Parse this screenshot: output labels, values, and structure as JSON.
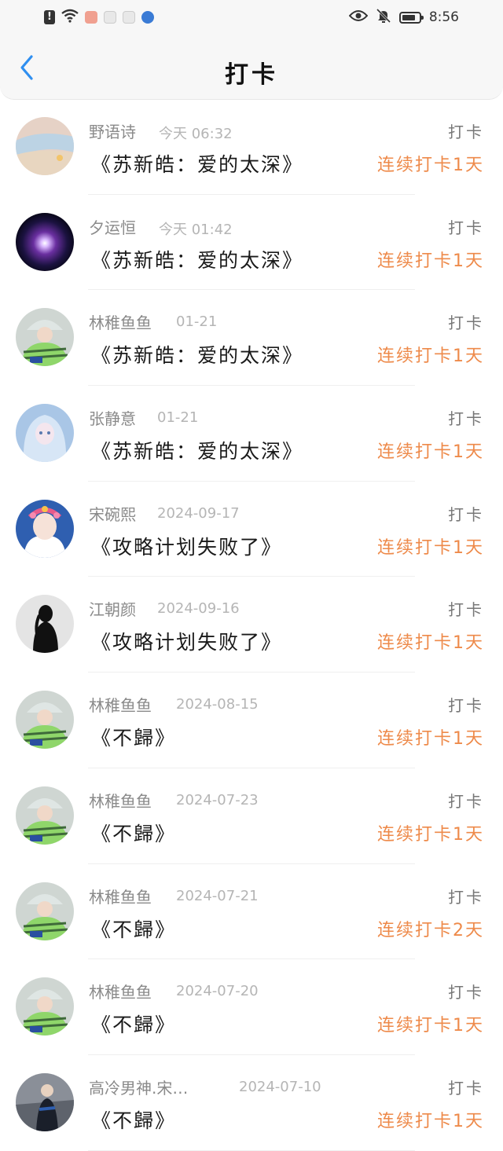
{
  "status_bar": {
    "time": "8:56",
    "left_icons": [
      "alert-icon",
      "wifi-icon",
      "app-icon",
      "app-icon",
      "app-icon",
      "app-icon"
    ],
    "right_icons": [
      "eye-icon",
      "bell-off-icon",
      "battery-icon"
    ]
  },
  "header": {
    "title": "打卡",
    "back_icon": "chevron-left-icon",
    "accent": "#2f8ff0"
  },
  "colors": {
    "streak": "#ee8a4a",
    "name": "#8a8a8a",
    "time": "#b5b5b5"
  },
  "items": [
    {
      "name": "野语诗",
      "time": "今天 06:32",
      "title": "《苏新皓：爱的太深》",
      "action": "打卡",
      "streak": "连续打卡1天"
    },
    {
      "name": "夕运恒",
      "time": "今天 01:42",
      "title": "《苏新皓：爱的太深》",
      "action": "打卡",
      "streak": "连续打卡1天"
    },
    {
      "name": "林稚鱼鱼",
      "time": "01-21",
      "title": "《苏新皓：爱的太深》",
      "action": "打卡",
      "streak": "连续打卡1天"
    },
    {
      "name": "张静意",
      "time": "01-21",
      "title": "《苏新皓：爱的太深》",
      "action": "打卡",
      "streak": "连续打卡1天"
    },
    {
      "name": "宋碗熙",
      "time": "2024-09-17",
      "title": "《攻略计划失败了》",
      "action": "打卡",
      "streak": "连续打卡1天"
    },
    {
      "name": "江朝颜",
      "time": "2024-09-16",
      "title": "《攻略计划失败了》",
      "action": "打卡",
      "streak": "连续打卡1天"
    },
    {
      "name": "林稚鱼鱼",
      "time": "2024-08-15",
      "title": "《不歸》",
      "action": "打卡",
      "streak": "连续打卡1天"
    },
    {
      "name": "林稚鱼鱼",
      "time": "2024-07-23",
      "title": "《不歸》",
      "action": "打卡",
      "streak": "连续打卡1天"
    },
    {
      "name": "林稚鱼鱼",
      "time": "2024-07-21",
      "title": "《不歸》",
      "action": "打卡",
      "streak": "连续打卡2天"
    },
    {
      "name": "林稚鱼鱼",
      "time": "2024-07-20",
      "title": "《不歸》",
      "action": "打卡",
      "streak": "连续打卡1天"
    },
    {
      "name": "高冷男神.宋…",
      "time": "2024-07-10",
      "title": "《不歸》",
      "action": "打卡",
      "streak": "连续打卡1天"
    }
  ]
}
